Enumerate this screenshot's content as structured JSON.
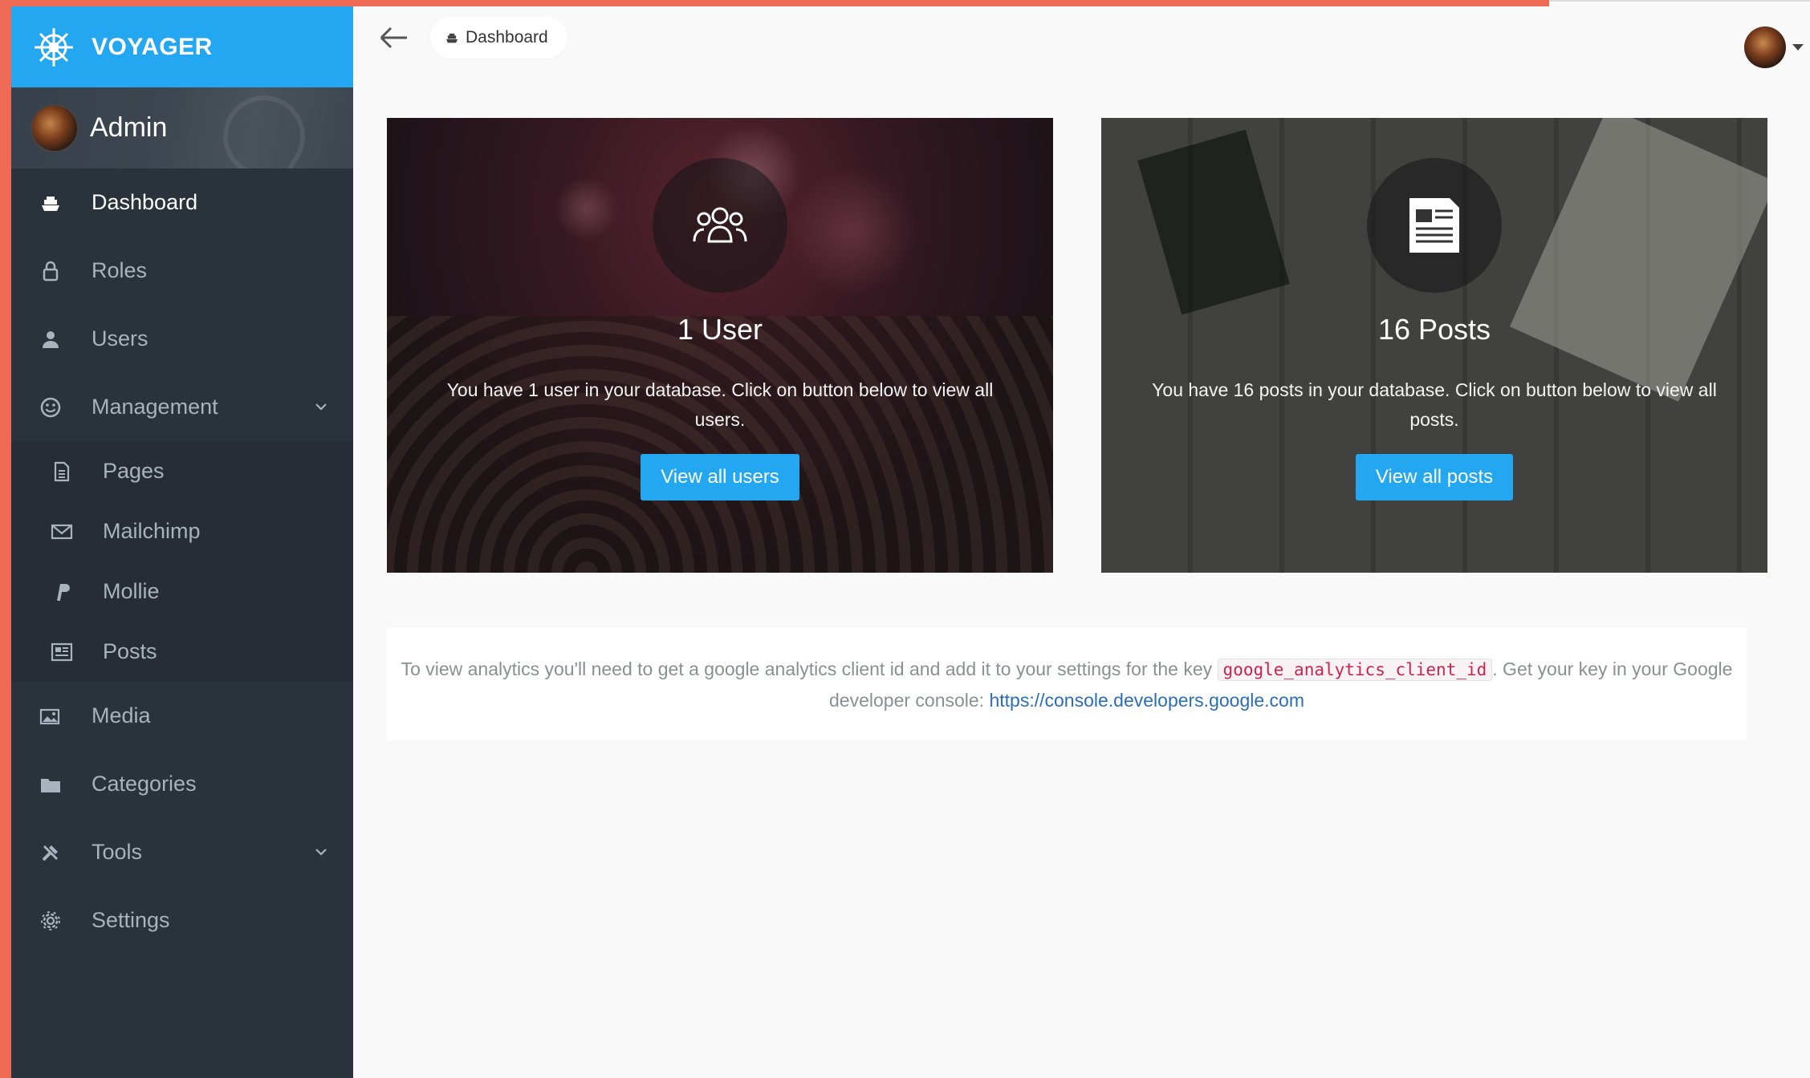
{
  "brand": {
    "name": "VOYAGER"
  },
  "profile": {
    "name": "Admin"
  },
  "sidebar": {
    "items": [
      {
        "label": "Dashboard",
        "icon": "boat-icon",
        "active": true
      },
      {
        "label": "Roles",
        "icon": "lock-icon"
      },
      {
        "label": "Users",
        "icon": "person-icon"
      },
      {
        "label": "Management",
        "icon": "smiley-icon",
        "expanded": true
      },
      {
        "label": "Media",
        "icon": "images-icon"
      },
      {
        "label": "Categories",
        "icon": "folder-icon"
      },
      {
        "label": "Tools",
        "icon": "tools-icon"
      },
      {
        "label": "Settings",
        "icon": "gear-icon"
      }
    ],
    "management_children": [
      {
        "label": "Pages",
        "icon": "file-icon"
      },
      {
        "label": "Mailchimp",
        "icon": "envelope-icon"
      },
      {
        "label": "Mollie",
        "icon": "paypal-icon"
      },
      {
        "label": "Posts",
        "icon": "news-icon"
      }
    ]
  },
  "breadcrumb": {
    "label": "Dashboard"
  },
  "cards": [
    {
      "title": "1 User",
      "text": "You have 1 user in your database. Click on button below to view all users.",
      "button": "View all users",
      "icon": "people-icon"
    },
    {
      "title": "16 Posts",
      "text": "You have 16 posts in your database. Click on button below to view all posts.",
      "button": "View all posts",
      "icon": "newspaper-icon"
    }
  ],
  "analytics": {
    "text_before": "To view analytics you'll need to get a google analytics client id and add it to your settings for the key ",
    "key": "google_analytics_client_id",
    "text_after": ". Get your key in your Google developer console: ",
    "link": "https://console.developers.google.com"
  },
  "colors": {
    "accent": "#22a7f0",
    "sidebar_bg": "#2a323c",
    "frame_border": "#ef6a55"
  }
}
